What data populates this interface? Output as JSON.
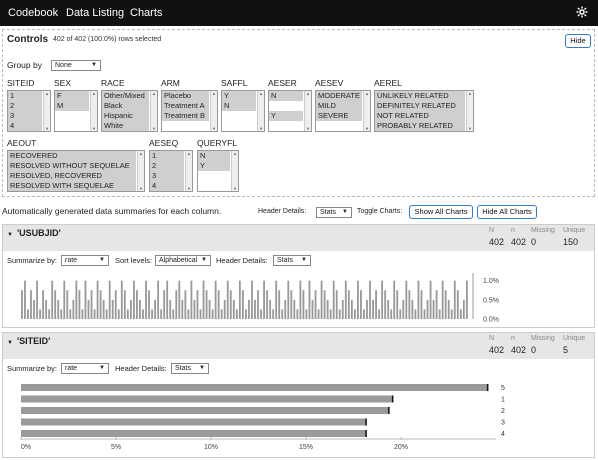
{
  "nav": {
    "tabs": [
      "Codebook",
      "Data Listing",
      "Charts"
    ]
  },
  "controls": {
    "title": "Controls",
    "rows_selected": "402 of 402 (100.0%) rows selected",
    "hide_label": "Hide",
    "group_by_label": "Group by",
    "group_by_value": "None",
    "filters": [
      {
        "name": "SITEID",
        "options": [
          "1",
          "2",
          "3",
          "4"
        ]
      },
      {
        "name": "SEX",
        "options": [
          "F",
          "M"
        ]
      },
      {
        "name": "RACE",
        "options": [
          "Other/Mixed",
          "Black",
          "Hispanic",
          "White"
        ]
      },
      {
        "name": "ARM",
        "options": [
          "Placebo",
          "Treatment A",
          "Treatment B"
        ]
      },
      {
        "name": "SAFFL",
        "options": [
          "Y",
          "N"
        ]
      },
      {
        "name": "AESER",
        "options": [
          "N",
          "",
          "Y"
        ]
      },
      {
        "name": "AESEV",
        "options": [
          "MODERATE",
          "MILD",
          "SEVERE"
        ]
      },
      {
        "name": "AEREL",
        "options": [
          "UNLIKELY RELATED",
          "DEFINITELY RELATED",
          "NOT RELATED",
          "PROBABLY RELATED"
        ]
      },
      {
        "name": "AEOUT",
        "options": [
          "RECOVERED",
          "RESOLVED WITHOUT SEQUELAE",
          "RESOLVED, RECOVERED",
          "RESOLVED WITH SEQUELAE"
        ]
      },
      {
        "name": "AESEQ",
        "options": [
          "1",
          "2",
          "3",
          "4"
        ]
      },
      {
        "name": "QUERYFL",
        "options": [
          "N",
          "Y"
        ]
      }
    ]
  },
  "summary": {
    "text": "Automatically generated data summaries for each column.",
    "header_details_label": "Header Details:",
    "header_details_value": "Stats",
    "toggle_label": "Toggle Charts:",
    "show_all": "Show All Charts",
    "hide_all": "Hide All Charts"
  },
  "panels": [
    {
      "title": "'USUBJID'",
      "stats": {
        "N_label": "N",
        "n_label": "n",
        "missing_label": "Missing",
        "unique_label": "Unique",
        "N": "402",
        "n": "402",
        "missing": "0",
        "unique": "150"
      },
      "summarize_label": "Summarize by:",
      "summarize_value": "rate",
      "sort_label": "Sort levels:",
      "sort_value": "Alphabetical",
      "header_details_label": "Header Details:",
      "header_details_value": "Stats"
    },
    {
      "title": "'SITEID'",
      "stats": {
        "N_label": "N",
        "n_label": "n",
        "missing_label": "Missing",
        "unique_label": "Unique",
        "N": "402",
        "n": "402",
        "missing": "0",
        "unique": "5"
      },
      "summarize_label": "Summarize by:",
      "summarize_value": "rate",
      "header_details_label": "Header Details:",
      "header_details_value": "Stats"
    }
  ],
  "chart_data": [
    {
      "type": "bar",
      "orientation": "vertical",
      "y_tick_labels": [
        "1.0%",
        "0.5%",
        "0.0%"
      ],
      "ylim": [
        0,
        1.2
      ],
      "values": [
        0.75,
        1.0,
        0.25,
        0.75,
        0.5,
        1.0,
        0.25,
        0.75,
        0.5,
        0.25,
        1.0,
        0.75,
        0.5,
        0.25,
        1.0,
        0.75,
        0.25,
        0.5,
        1.0,
        0.75,
        0.25,
        1.0,
        0.5,
        0.75,
        0.25,
        1.0,
        0.75,
        0.5,
        0.25,
        1.0,
        0.5,
        0.75,
        0.25,
        1.0,
        0.75,
        0.25,
        0.5,
        1.0,
        0.75,
        0.5,
        0.25,
        1.0,
        0.75,
        0.25,
        0.5,
        1.0,
        0.25,
        0.75,
        1.0,
        0.5,
        0.25,
        0.75,
        1.0,
        0.5,
        0.75,
        0.25,
        1.0,
        0.5,
        0.75,
        0.25,
        1.0,
        0.75,
        0.5,
        0.25,
        1.0,
        0.75,
        0.25,
        0.5,
        1.0,
        0.75,
        0.5,
        0.25,
        1.0,
        0.75,
        0.25,
        0.5,
        1.0,
        0.5,
        0.75,
        0.25,
        1.0,
        0.75,
        0.5,
        0.25,
        1.0,
        0.75,
        0.25,
        0.5,
        1.0,
        0.75,
        0.5,
        0.25,
        1.0,
        0.75,
        0.25,
        1.0,
        0.5,
        0.75,
        0.25,
        1.0,
        0.75,
        0.5,
        0.25,
        1.0,
        0.75,
        0.25,
        0.5,
        1.0,
        0.75,
        0.5,
        0.25,
        1.0,
        0.75,
        0.25,
        0.5,
        1.0,
        0.5,
        0.75,
        0.25,
        1.0,
        0.75,
        0.5,
        0.25,
        1.0,
        0.75,
        0.25,
        0.5,
        1.0,
        0.75,
        0.5,
        0.25,
        1.0,
        0.75,
        0.25,
        0.5,
        1.0,
        0.5,
        0.75,
        0.25,
        1.0,
        0.75,
        0.5,
        0.25,
        1.0,
        0.75,
        0.25,
        0.5,
        1.0
      ]
    },
    {
      "type": "bar",
      "orientation": "horizontal",
      "categories": [
        "5",
        "1",
        "2",
        "3",
        "4"
      ],
      "values": [
        24.6,
        19.6,
        19.4,
        18.2,
        18.2
      ],
      "x_tick_labels": [
        "0%",
        "5%",
        "10%",
        "15%",
        "20%"
      ],
      "xlim": [
        0,
        25
      ]
    }
  ]
}
